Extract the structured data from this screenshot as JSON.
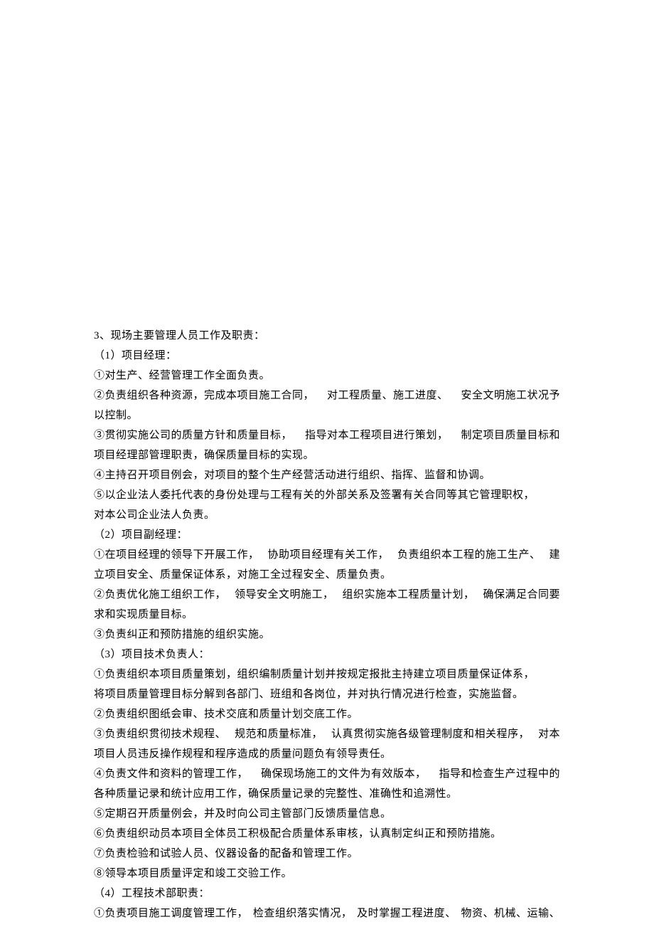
{
  "lines": [
    {
      "type": "plain",
      "text": "3、现场主要管理人员工作及职责："
    },
    {
      "type": "plain",
      "text": "（1）项目经理："
    },
    {
      "type": "plain",
      "text": "①对生产、经营管理工作全面负责。"
    },
    {
      "type": "justify",
      "segs": [
        "②负责组织各种资源，完成本项目施工合同，",
        "对工程质量、施工进度、",
        "安全文明施工状况予"
      ]
    },
    {
      "type": "plain",
      "text": "以控制。"
    },
    {
      "type": "justify",
      "segs": [
        "③贯彻实施公司的质量方针和质量目标，",
        "指导对本工程项目进行策划，",
        "制定项目质量目标和"
      ]
    },
    {
      "type": "plain",
      "text": "项目经理部管理职责，确保质量目标的实现。"
    },
    {
      "type": "plain",
      "text": "④主持召开项目例会，对项目的整个生产经营活动进行组织、指挥、监督和协调。"
    },
    {
      "type": "plain",
      "text": "⑤以企业法人委托代表的身份处理与工程有关的外部关系及签署有关合同等其它管理职权，"
    },
    {
      "type": "plain",
      "text": "对本公司企业法人负责。"
    },
    {
      "type": "plain",
      "text": "（2）项目副经理："
    },
    {
      "type": "justify",
      "segs": [
        "①在项目经理的领导下开展工作，",
        "协助项目经理有关工作，",
        "负责组织本工程的施工生产、",
        "建"
      ]
    },
    {
      "type": "plain",
      "text": "立项目安全、质量保证体系，对施工全过程安全、质量负责。"
    },
    {
      "type": "justify",
      "segs": [
        "②负责优化施工组织工作，",
        "领导安全文明施工，",
        "组织实施本工程质量计划，",
        "确保满足合同要"
      ]
    },
    {
      "type": "plain",
      "text": "求和实现质量目标。"
    },
    {
      "type": "plain",
      "text": "③负责纠正和预防措施的组织实施。"
    },
    {
      "type": "plain",
      "text": "（3）项目技术负责人："
    },
    {
      "type": "plain",
      "text": "①负责组织本项目质量策划，组织编制质量计划并按规定报批主持建立项目质量保证体系，"
    },
    {
      "type": "plain",
      "text": "将项目质量管理目标分解到各部门、班组和各岗位，并对执行情况进行检查，实施监督。"
    },
    {
      "type": "plain",
      "text": "②负责组织图纸会审、技术交底和质量计划交底工作。"
    },
    {
      "type": "justify",
      "segs": [
        "③负责组织贯彻技术规程、",
        "规范和质量标准，",
        "认真贯彻实施各级管理制度和相关程序，",
        "对本"
      ]
    },
    {
      "type": "plain",
      "text": "项目人员违反操作规程和程序造成的质量问题负有领导责任。"
    },
    {
      "type": "justify",
      "segs": [
        "④负责文件和资料的管理工作，",
        "确保现场施工的文件为有效版本，",
        "指导和检查生产过程中的"
      ]
    },
    {
      "type": "plain",
      "text": "各种质量记录和统计应用工作，确保质量记录的完整性、准确性和追溯性。"
    },
    {
      "type": "plain",
      "text": "⑤定期召开质量例会，并及时向公司主管部门反馈质量信息。"
    },
    {
      "type": "plain",
      "text": "⑥负责组织动员本项目全体员工积极配合质量体系审核，认真制定纠正和预防措施。"
    },
    {
      "type": "plain",
      "text": "⑦负责检验和试验人员、仪器设备的配备和管理工作。"
    },
    {
      "type": "plain",
      "text": "⑧领导本项目质量评定和竣工交验工作。"
    },
    {
      "type": "plain",
      "text": "（4）工程技术部职责："
    },
    {
      "type": "justify",
      "segs": [
        "①负责项目施工调度管理工作，",
        "检查组织落实情况，",
        "及时掌握工程进度、",
        "物资、机械、运输、"
      ]
    }
  ]
}
